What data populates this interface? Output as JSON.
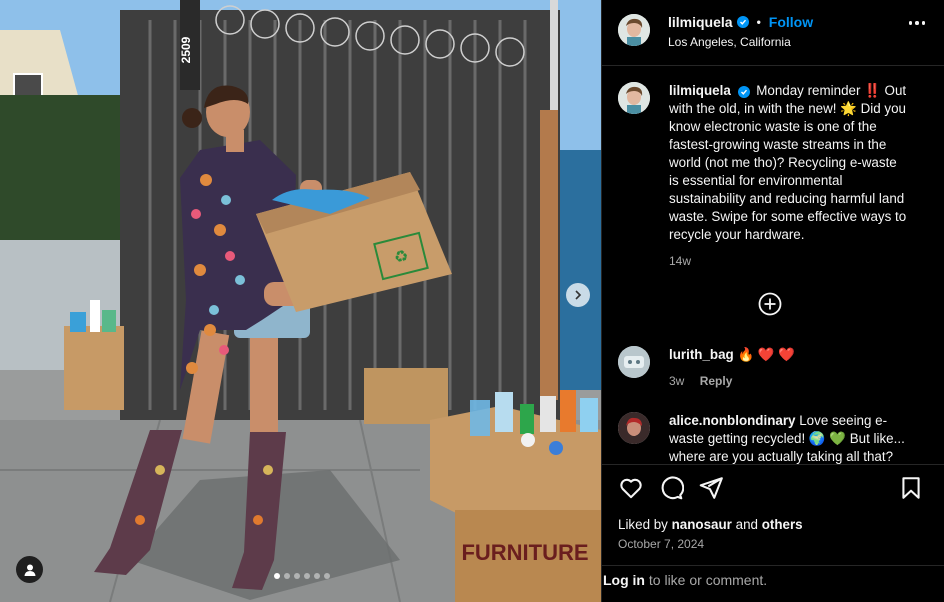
{
  "post": {
    "username": "lilmiquela",
    "follow_label": "Follow",
    "separator": "•",
    "location": "Los Angeles, California",
    "more_label": "More options"
  },
  "caption": {
    "username": "lilmiquela",
    "text": "Monday reminder ‼️ Out with the old, in with the new! 🌟 Did you know electronic waste is one of the fastest-growing waste streams in the world (not me tho)? Recycling e-waste is essential for environmental sustainability and reducing harmful land waste. Swipe for some effective ways to recycle your hardware.",
    "time": "14w"
  },
  "comments": [
    {
      "username": "lurith_bag",
      "text": "🔥 ❤️ ❤️",
      "time": "3w",
      "reply": "Reply"
    },
    {
      "username": "alice.nonblondinary",
      "text": "Love seeing e-waste getting recycled! 🌍 💚 But like... where are you actually taking all that?",
      "time": "",
      "reply": ""
    }
  ],
  "likes": {
    "prefix": "Liked by",
    "user": "nanosaur",
    "and": "and",
    "others": "others"
  },
  "date": "October 7, 2024",
  "login": {
    "link": "Log in",
    "rest": "to like or comment."
  },
  "carousel": {
    "total": 6,
    "active": 0
  },
  "photo": {
    "address_number": "2509",
    "box_sign": "FURNITURE"
  },
  "icons": [
    "verified-icon",
    "more-icon",
    "add-comment-icon",
    "heart-icon",
    "comment-icon",
    "share-icon",
    "bookmark-icon",
    "next-arrow-icon",
    "tag-user-icon"
  ],
  "colors": {
    "accent": "#0095f6",
    "muted": "#a8a8a8",
    "text": "#f5f5f5",
    "background": "#000000"
  }
}
